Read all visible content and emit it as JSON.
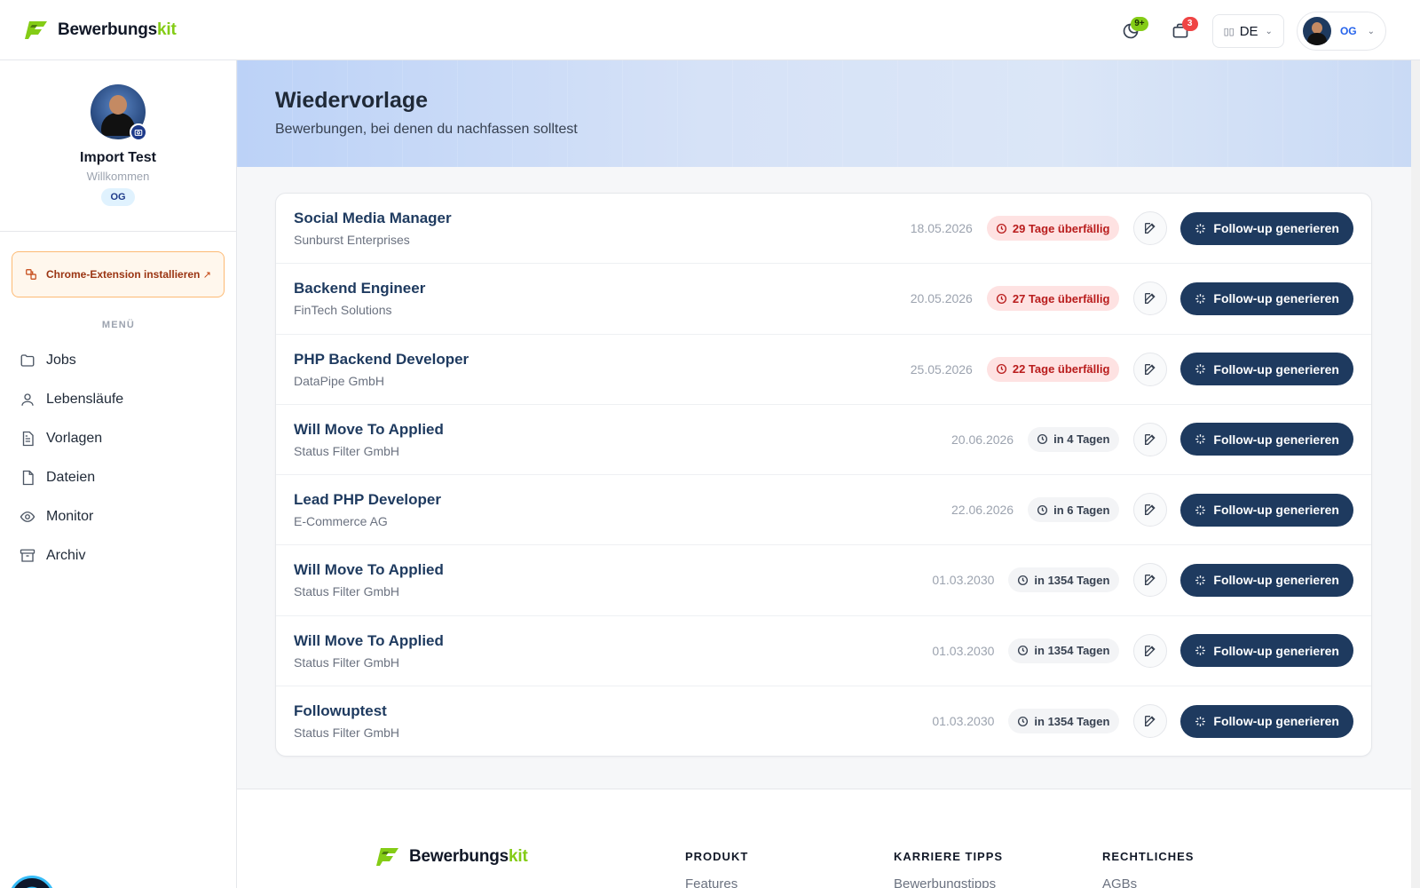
{
  "brand": {
    "name_main": "Bewerbungs",
    "name_accent": "kit"
  },
  "topbar": {
    "notifications_badge": "9+",
    "inbox_badge": "3",
    "language": "DE",
    "user_initials": "OG"
  },
  "sidebar": {
    "profile": {
      "name": "Import Test",
      "subtitle": "Willkommen",
      "initials": "OG"
    },
    "extension": {
      "label": "Chrome-Extension installieren"
    },
    "menu_title": "MENÜ",
    "items": [
      {
        "label": "Jobs",
        "icon": "folder-icon"
      },
      {
        "label": "Lebensläufe",
        "icon": "user-icon"
      },
      {
        "label": "Vorlagen",
        "icon": "document-text-icon"
      },
      {
        "label": "Dateien",
        "icon": "file-icon"
      },
      {
        "label": "Monitor",
        "icon": "eye-icon"
      },
      {
        "label": "Archiv",
        "icon": "archive-icon"
      }
    ]
  },
  "hero": {
    "title": "Wiedervorlage",
    "subtitle": "Bewerbungen, bei denen du nachfassen solltest"
  },
  "followups": [
    {
      "title": "Social Media Manager",
      "company": "Sunburst Enterprises",
      "date": "18.05.2026",
      "status": "29 Tage überfällig",
      "overdue": true,
      "action": "Follow-up generieren"
    },
    {
      "title": "Backend Engineer",
      "company": "FinTech Solutions",
      "date": "20.05.2026",
      "status": "27 Tage überfällig",
      "overdue": true,
      "action": "Follow-up generieren"
    },
    {
      "title": "PHP Backend Developer",
      "company": "DataPipe GmbH",
      "date": "25.05.2026",
      "status": "22 Tage überfällig",
      "overdue": true,
      "action": "Follow-up generieren"
    },
    {
      "title": "Will Move To Applied",
      "company": "Status Filter GmbH",
      "date": "20.06.2026",
      "status": "in 4 Tagen",
      "overdue": false,
      "action": "Follow-up generieren"
    },
    {
      "title": "Lead PHP Developer",
      "company": "E-Commerce AG",
      "date": "22.06.2026",
      "status": "in 6 Tagen",
      "overdue": false,
      "action": "Follow-up generieren"
    },
    {
      "title": "Will Move To Applied",
      "company": "Status Filter GmbH",
      "date": "01.03.2030",
      "status": "in 1354 Tagen",
      "overdue": false,
      "action": "Follow-up generieren"
    },
    {
      "title": "Will Move To Applied",
      "company": "Status Filter GmbH",
      "date": "01.03.2030",
      "status": "in 1354 Tagen",
      "overdue": false,
      "action": "Follow-up generieren"
    },
    {
      "title": "Followuptest",
      "company": "Status Filter GmbH",
      "date": "01.03.2030",
      "status": "in 1354 Tagen",
      "overdue": false,
      "action": "Follow-up generieren"
    }
  ],
  "footer": {
    "columns": [
      {
        "heading": "PRODUKT",
        "first_link": "Features"
      },
      {
        "heading": "KARRIERE TIPPS",
        "first_link": "Bewerbungstipps"
      },
      {
        "heading": "RECHTLICHES",
        "first_link": "AGBs"
      }
    ]
  },
  "colors": {
    "accent_green": "#84cc16",
    "navy": "#1e3a5f",
    "overdue_red": "#b91c1c"
  }
}
